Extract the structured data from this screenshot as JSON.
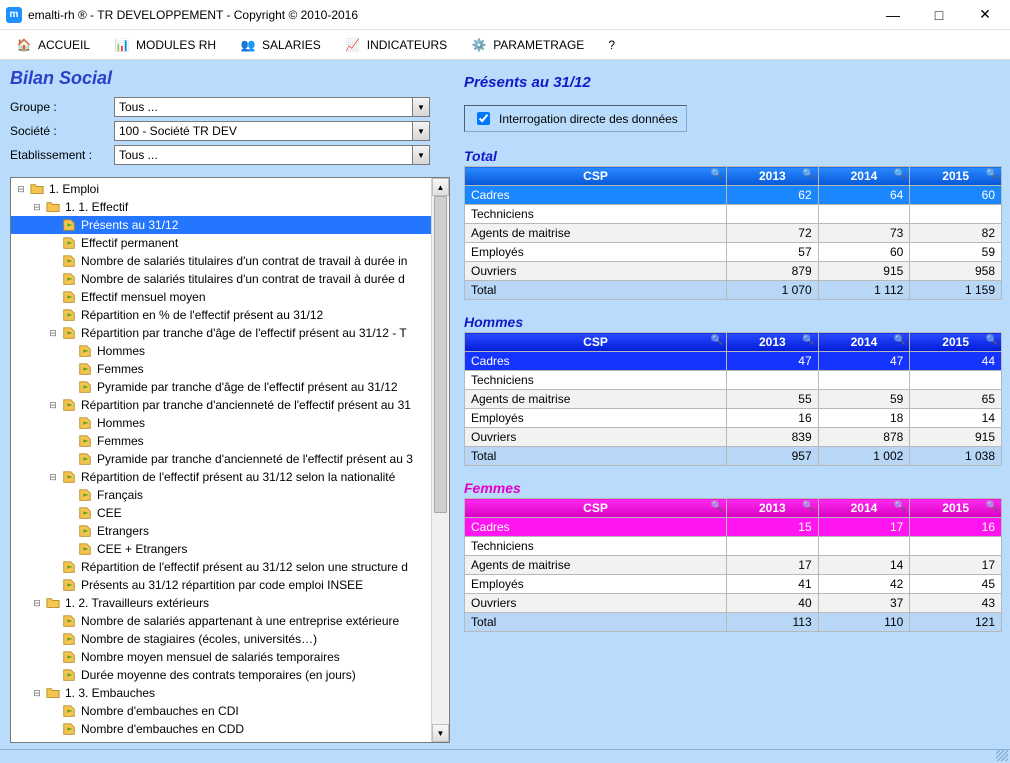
{
  "window": {
    "title": "emalti-rh ® - TR DEVELOPPEMENT - Copyright © 2010-2016",
    "app_icon_letter": "m"
  },
  "menu": {
    "items": [
      {
        "icon": "home",
        "label": "ACCUEIL"
      },
      {
        "icon": "modules",
        "label": "MODULES RH"
      },
      {
        "icon": "salaries",
        "label": "SALARIES"
      },
      {
        "icon": "indicators",
        "label": "INDICATEURS"
      },
      {
        "icon": "settings",
        "label": "PARAMETRAGE"
      },
      {
        "icon": "help",
        "label": "?"
      }
    ]
  },
  "page": {
    "heading": "Bilan Social",
    "filters": {
      "groupe_label": "Groupe :",
      "groupe_value": "Tous ...",
      "societe_label": "Société :",
      "societe_value": "100 - Société TR DEV",
      "etab_label": "Etablissement :",
      "etab_value": "Tous ..."
    }
  },
  "tree": [
    {
      "depth": 0,
      "expander": "minus",
      "icon": "folder",
      "label": "1. Emploi"
    },
    {
      "depth": 1,
      "expander": "minus",
      "icon": "folder",
      "label": "1. 1. Effectif"
    },
    {
      "depth": 2,
      "expander": "blank",
      "icon": "leaf",
      "label": "Présents au 31/12",
      "selected": true
    },
    {
      "depth": 2,
      "expander": "blank",
      "icon": "leaf",
      "label": "Effectif permanent"
    },
    {
      "depth": 2,
      "expander": "blank",
      "icon": "leaf",
      "label": "Nombre de salariés titulaires d'un contrat de travail à durée in"
    },
    {
      "depth": 2,
      "expander": "blank",
      "icon": "leaf",
      "label": "Nombre de salariés titulaires d'un contrat de travail à durée d"
    },
    {
      "depth": 2,
      "expander": "blank",
      "icon": "leaf",
      "label": "Effectif mensuel moyen"
    },
    {
      "depth": 2,
      "expander": "blank",
      "icon": "leaf",
      "label": "Répartition en % de l'effectif présent au 31/12"
    },
    {
      "depth": 2,
      "expander": "minus",
      "icon": "leaf",
      "label": "Répartition par tranche d'âge de l'effectif présent au 31/12 - T"
    },
    {
      "depth": 3,
      "expander": "blank",
      "icon": "leaf",
      "label": "Hommes"
    },
    {
      "depth": 3,
      "expander": "blank",
      "icon": "leaf",
      "label": "Femmes"
    },
    {
      "depth": 3,
      "expander": "blank",
      "icon": "leaf",
      "label": "Pyramide par tranche d'âge de l'effectif présent au 31/12"
    },
    {
      "depth": 2,
      "expander": "minus",
      "icon": "leaf",
      "label": "Répartition par tranche d'ancienneté de l'effectif présent au 31"
    },
    {
      "depth": 3,
      "expander": "blank",
      "icon": "leaf",
      "label": "Hommes"
    },
    {
      "depth": 3,
      "expander": "blank",
      "icon": "leaf",
      "label": "Femmes"
    },
    {
      "depth": 3,
      "expander": "blank",
      "icon": "leaf",
      "label": "Pyramide par tranche d'ancienneté de l'effectif présent au 3"
    },
    {
      "depth": 2,
      "expander": "minus",
      "icon": "leaf",
      "label": "Répartition de l'effectif présent au 31/12 selon la nationalité"
    },
    {
      "depth": 3,
      "expander": "blank",
      "icon": "leaf",
      "label": "Français"
    },
    {
      "depth": 3,
      "expander": "blank",
      "icon": "leaf",
      "label": "CEE"
    },
    {
      "depth": 3,
      "expander": "blank",
      "icon": "leaf",
      "label": "Etrangers"
    },
    {
      "depth": 3,
      "expander": "blank",
      "icon": "leaf",
      "label": "CEE + Etrangers"
    },
    {
      "depth": 2,
      "expander": "blank",
      "icon": "leaf",
      "label": "Répartition de l'effectif présent au 31/12 selon une structure d"
    },
    {
      "depth": 2,
      "expander": "blank",
      "icon": "leaf",
      "label": "Présents au 31/12 répartition par code emploi INSEE"
    },
    {
      "depth": 1,
      "expander": "minus",
      "icon": "folder",
      "label": "1. 2. Travailleurs extérieurs"
    },
    {
      "depth": 2,
      "expander": "blank",
      "icon": "leaf",
      "label": "Nombre de salariés appartenant à une entreprise extérieure"
    },
    {
      "depth": 2,
      "expander": "blank",
      "icon": "leaf",
      "label": "Nombre de stagiaires (écoles, universités…)"
    },
    {
      "depth": 2,
      "expander": "blank",
      "icon": "leaf",
      "label": "Nombre moyen mensuel de salariés temporaires"
    },
    {
      "depth": 2,
      "expander": "blank",
      "icon": "leaf",
      "label": "Durée moyenne des contrats temporaires (en jours)"
    },
    {
      "depth": 1,
      "expander": "minus",
      "icon": "folder",
      "label": "1. 3. Embauches"
    },
    {
      "depth": 2,
      "expander": "blank",
      "icon": "leaf",
      "label": "Nombre d'embauches en CDI"
    },
    {
      "depth": 2,
      "expander": "blank",
      "icon": "leaf",
      "label": "Nombre d'embauches en CDD"
    }
  ],
  "right": {
    "title": "Présents au 31/12",
    "checkbox_label": "Interrogation directe des données",
    "checkbox_checked": true,
    "sections": [
      {
        "key": "total",
        "title": "Total",
        "palette": "total"
      },
      {
        "key": "hommes",
        "title": "Hommes",
        "palette": "hommes"
      },
      {
        "key": "femmes",
        "title": "Femmes",
        "palette": "femmes"
      }
    ],
    "columns": [
      "CSP",
      "2013",
      "2014",
      "2015"
    ],
    "rows": {
      "total": [
        {
          "label": "Cadres",
          "v": [
            "62",
            "64",
            "60"
          ],
          "highlight": true
        },
        {
          "label": "Techniciens",
          "v": [
            "",
            "",
            ""
          ]
        },
        {
          "label": "Agents de maitrise",
          "v": [
            "72",
            "73",
            "82"
          ]
        },
        {
          "label": "Employés",
          "v": [
            "57",
            "60",
            "59"
          ]
        },
        {
          "label": "Ouvriers",
          "v": [
            "879",
            "915",
            "958"
          ]
        },
        {
          "label": "Total",
          "v": [
            "1 070",
            "1 112",
            "1 159"
          ],
          "total": true
        }
      ],
      "hommes": [
        {
          "label": "Cadres",
          "v": [
            "47",
            "47",
            "44"
          ],
          "highlight": true
        },
        {
          "label": "Techniciens",
          "v": [
            "",
            "",
            ""
          ]
        },
        {
          "label": "Agents de maitrise",
          "v": [
            "55",
            "59",
            "65"
          ]
        },
        {
          "label": "Employés",
          "v": [
            "16",
            "18",
            "14"
          ]
        },
        {
          "label": "Ouvriers",
          "v": [
            "839",
            "878",
            "915"
          ]
        },
        {
          "label": "Total",
          "v": [
            "957",
            "1 002",
            "1 038"
          ],
          "total": true
        }
      ],
      "femmes": [
        {
          "label": "Cadres",
          "v": [
            "15",
            "17",
            "16"
          ],
          "highlight": true
        },
        {
          "label": "Techniciens",
          "v": [
            "",
            "",
            ""
          ]
        },
        {
          "label": "Agents de maitrise",
          "v": [
            "17",
            "14",
            "17"
          ]
        },
        {
          "label": "Employés",
          "v": [
            "41",
            "42",
            "45"
          ]
        },
        {
          "label": "Ouvriers",
          "v": [
            "40",
            "37",
            "43"
          ]
        },
        {
          "label": "Total",
          "v": [
            "113",
            "110",
            "121"
          ],
          "total": true
        }
      ]
    }
  }
}
